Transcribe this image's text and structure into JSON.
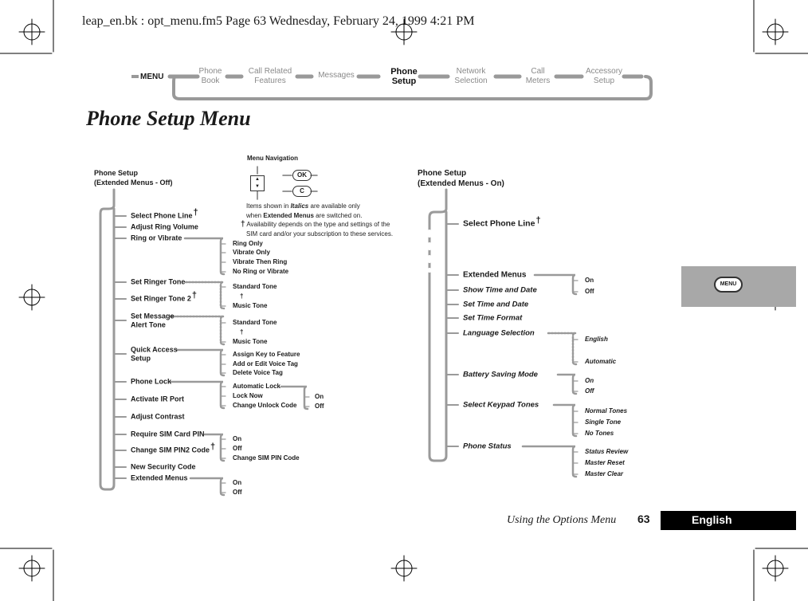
{
  "print_header": "leap_en.bk : opt_menu.fm5  Page 63  Wednesday, February 24, 1999  4:21 PM",
  "nav": {
    "menu_label": "MENU",
    "items": [
      {
        "line1": "Phone",
        "line2": "Book"
      },
      {
        "line1": "Call Related",
        "line2": "Features"
      },
      {
        "line1": "Messages",
        "line2": ""
      },
      {
        "line1": "Phone",
        "line2": "Setup",
        "current": true
      },
      {
        "line1": "Network",
        "line2": "Selection"
      },
      {
        "line1": "Call",
        "line2": "Meters"
      },
      {
        "line1": "Accessory",
        "line2": "Setup"
      }
    ]
  },
  "page_title": "Phone Setup Menu",
  "legend": {
    "title": "Menu Navigation",
    "ok_label": "OK",
    "c_label": "C",
    "note1a": "Items shown in ",
    "note1b": "Italics",
    "note1c": " are available only",
    "note2a": "when ",
    "note2b": "Extended Menus",
    "note2c": " are switched on.",
    "dagger": "†",
    "note3": "Availability depends on the type and settings of the",
    "note4": "SIM card and/or your subscription to these services."
  },
  "left_tree": {
    "header1": "Phone Setup",
    "header2": "(Extended Menus - Off)",
    "items": [
      "Select Phone Line",
      "Adjust Ring Volume",
      "Ring or Vibrate",
      "Set Ringer Tone",
      "Set Ringer Tone 2",
      "Set Message",
      "Alert Tone",
      "Quick Access",
      "Setup",
      "Phone Lock",
      "Activate IR Port",
      "Adjust Contrast",
      "Require SIM Card PIN",
      "Change SIM PIN2 Code",
      "New Security Code",
      "Extended Menus"
    ],
    "ring_or_vibrate": [
      "Ring Only",
      "Vibrate Only",
      "Vibrate Then Ring",
      "No Ring or Vibrate"
    ],
    "ringer_tone": [
      "Standard Tone",
      "Music Tone"
    ],
    "message_tone": [
      "Standard Tone",
      "Music Tone"
    ],
    "quick_access": [
      "Assign Key to Feature",
      "Add or Edit Voice Tag",
      "Delete Voice Tag"
    ],
    "phone_lock": [
      "Automatic Lock",
      "Lock Now",
      "Change Unlock Code"
    ],
    "auto_lock": [
      "On",
      "Off"
    ],
    "sim_pin": [
      "On",
      "Off",
      "Change SIM PIN Code"
    ],
    "extended": [
      "On",
      "Off"
    ]
  },
  "right_tree": {
    "header1": "Phone Setup",
    "header2": "(Extended Menus - On)",
    "items": [
      "Select Phone Line",
      "Extended Menus",
      "Show Time and Date",
      "Set Time and Date",
      "Set Time Format",
      "Language Selection",
      "Battery Saving Mode",
      "Select Keypad Tones",
      "Phone Status"
    ],
    "extended": [
      "On",
      "Off"
    ],
    "language": [
      "English",
      "Automatic"
    ],
    "battery": [
      "On",
      "Off"
    ],
    "keypad": [
      "Normal Tones",
      "Single Tone",
      "No Tones"
    ],
    "status": [
      "Status Review",
      "Master Reset",
      "Master Clear"
    ]
  },
  "side_tab": {
    "label": "MENU"
  },
  "footer": {
    "section": "Using the Options Menu",
    "page": "63",
    "language": "English"
  },
  "colors": {
    "tree_gray": "#9a9a9a",
    "tab_gray": "#a8a8a8",
    "footer_box": "#000000"
  }
}
